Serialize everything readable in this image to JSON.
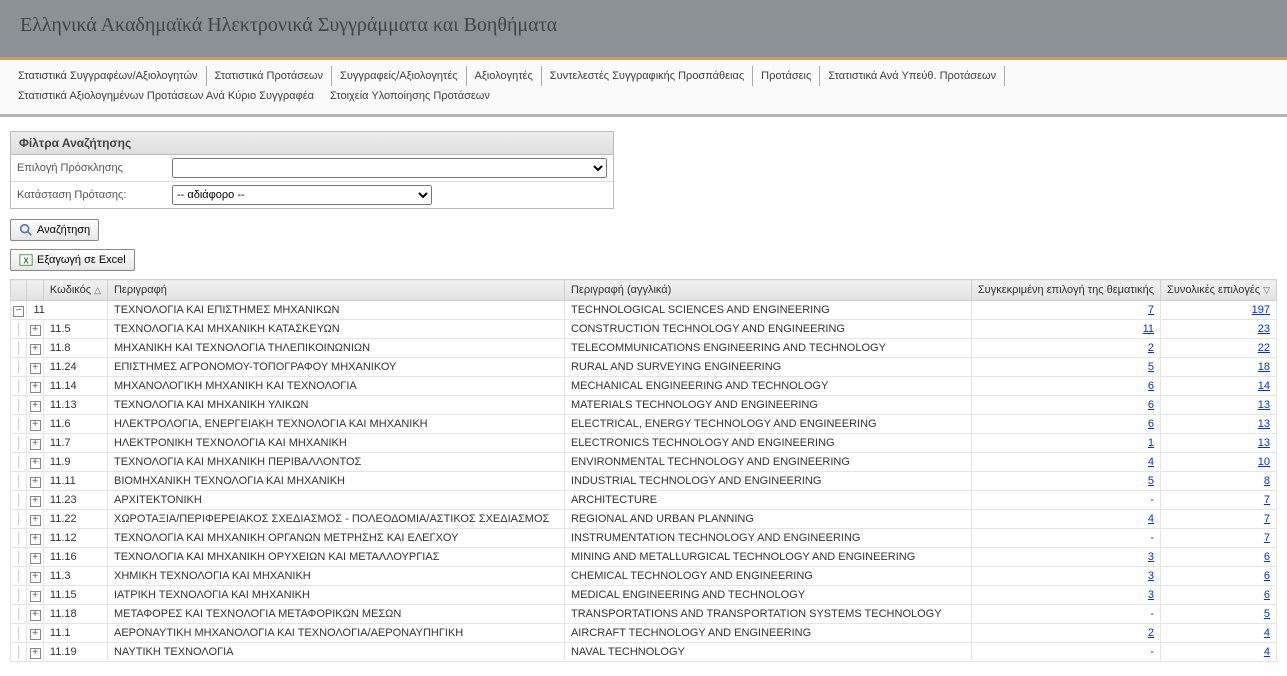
{
  "title": "Ελληνικά Ακαδημαϊκά Ηλεκτρονικά Συγγράμματα και Βοηθήματα",
  "menu": [
    "Στατιστικά Συγγραφέων/Αξιολογητών",
    "Στατιστικά Προτάσεων",
    "Συγγραφείς/Αξιολογητές",
    "Αξιολογητές",
    "Συντελεστές Συγγραφικής Προσπάθειας",
    "Προτάσεις",
    "Στατιστικά Ανά Υπεύθ. Προτάσεων",
    "Στατιστικά Αξιολογημένων Προτάσεων Ανά Κύριο Συγγραφέα",
    "Στοιχεία Υλοποίησης Προτάσεων"
  ],
  "filters": {
    "header": "Φίλτρα Αναζήτησης",
    "invitation_label": "Επιλογή Πρόσκλησης",
    "invitation_value": "",
    "status_label": "Κατάσταση Πρότασης:",
    "status_value": "-- αδιάφορο --"
  },
  "buttons": {
    "search": "Αναζήτηση",
    "excel": "Εξαγωγή σε Excel"
  },
  "grid": {
    "headers": {
      "code": "Κωδικός",
      "desc": "Περιγραφή",
      "desc_en": "Περιγραφή (αγγλικά)",
      "specific": "Συγκεκριμένη επιλογή της θεματικής",
      "total": "Συνολικές επιλογές"
    },
    "root": {
      "code": "11",
      "desc": "ΤΕΧΝΟΛΟΓΙΑ ΚΑΙ ΕΠΙΣΤΗΜΕΣ ΜΗΧΑΝΙΚΩΝ",
      "desc_en": "TECHNOLOGICAL SCIENCES AND ENGINEERING",
      "specific": "7",
      "total": "197"
    },
    "rows": [
      {
        "code": "11.5",
        "desc": "ΤΕΧΝΟΛΟΓΙΑ ΚΑΙ ΜΗΧΑΝΙΚΗ ΚΑΤΑΣΚΕΥΩΝ",
        "desc_en": "CONSTRUCTION TECHNOLOGY AND ENGINEERING",
        "specific": "11",
        "total": "23"
      },
      {
        "code": "11.8",
        "desc": "ΜΗΧΑΝΙΚΗ ΚΑΙ ΤΕΧΝΟΛΟΓΙΑ ΤΗΛΕΠΙΚΟΙΝΩΝΙΩΝ",
        "desc_en": "TELECOMMUNICATIONS ENGINEERING AND TECHNOLOGY",
        "specific": "2",
        "total": "22"
      },
      {
        "code": "11.24",
        "desc": "ΕΠΙΣΤΗΜΕΣ ΑΓΡΟΝΟΜΟΥ-ΤΟΠΟΓΡΑΦΟΥ ΜΗΧΑΝΙΚΟΥ",
        "desc_en": "RURAL AND SURVEYING ENGINEERING",
        "specific": "5",
        "total": "18"
      },
      {
        "code": "11.14",
        "desc": "ΜΗΧΑΝΟΛΟΓΙΚΗ ΜΗΧΑΝΙΚΗ ΚΑΙ ΤΕΧΝΟΛΟΓΙΑ",
        "desc_en": "MECHANICAL ENGINEERING AND TECHNOLOGY",
        "specific": "6",
        "total": "14"
      },
      {
        "code": "11.13",
        "desc": "ΤΕΧΝΟΛΟΓΙΑ ΚΑΙ ΜΗΧΑΝΙΚΗ ΥΛΙΚΩΝ",
        "desc_en": "MATERIALS TECHNOLOGY AND ENGINEERING",
        "specific": "6",
        "total": "13"
      },
      {
        "code": "11.6",
        "desc": "ΗΛΕΚΤΡΟΛΟΓΙΑ, ΕΝΕΡΓΕΙΑΚΗ ΤΕΧΝΟΛΟΓΙΑ ΚΑΙ ΜΗΧΑΝΙΚΗ",
        "desc_en": "ELECTRICAL, ENERGY TECHNOLOGY AND ENGINEERING",
        "specific": "6",
        "total": "13"
      },
      {
        "code": "11.7",
        "desc": "ΗΛΕΚΤΡΟΝΙΚΗ ΤΕΧΝΟΛΟΓΙΑ ΚΑΙ ΜΗΧΑΝΙΚΗ",
        "desc_en": "ELECTRONICS TECHNOLOGY AND ENGINEERING",
        "specific": "1",
        "total": "13"
      },
      {
        "code": "11.9",
        "desc": "ΤΕΧΝΟΛΟΓΙΑ ΚΑΙ ΜΗΧΑΝΙΚΗ ΠΕΡΙΒΑΛΛΟΝΤΟΣ",
        "desc_en": "ENVIRONMENTAL TECHNOLOGY AND ENGINEERING",
        "specific": "4",
        "total": "10"
      },
      {
        "code": "11.11",
        "desc": "ΒΙΟΜΗΧΑΝΙΚΗ ΤΕΧΝΟΛΟΓΙΑ ΚΑΙ ΜΗΧΑΝΙΚΗ",
        "desc_en": "INDUSTRIAL TECHNOLOGY AND ENGINEERING",
        "specific": "5",
        "total": "8"
      },
      {
        "code": "11.23",
        "desc": "ΑΡΧΙΤΕΚΤΟΝΙΚΗ",
        "desc_en": "ARCHITECTURE",
        "specific": "-",
        "total": "7"
      },
      {
        "code": "11.22",
        "desc": "ΧΩΡΟΤΑΞΙΑ/ΠΕΡΙΦΕΡΕΙΑΚΟΣ ΣΧΕΔΙΑΣΜΟΣ - ΠΟΛΕΟΔΟΜΙΑ/ΑΣΤΙΚΟΣ ΣΧΕΔΙΑΣΜΟΣ",
        "desc_en": "REGIONAL AND URBAN PLANNING",
        "specific": "4",
        "total": "7"
      },
      {
        "code": "11.12",
        "desc": "ΤΕΧΝΟΛΟΓΙΑ ΚΑΙ ΜΗΧΑΝΙΚΗ ΟΡΓΑΝΩΝ ΜΕΤΡΗΣΗΣ ΚΑΙ ΕΛΕΓΧΟΥ",
        "desc_en": "INSTRUMENTATION TECHNOLOGY AND ENGINEERING",
        "specific": "-",
        "total": "7"
      },
      {
        "code": "11.16",
        "desc": "ΤΕΧΝΟΛΟΓΙΑ ΚΑΙ ΜΗΧΑΝΙΚΗ ΟΡΥΧΕΙΩΝ ΚΑΙ ΜΕΤΑΛΛΟΥΡΓΙΑΣ",
        "desc_en": "MINING AND METALLURGICAL TECHNOLOGY AND ENGINEERING",
        "specific": "3",
        "total": "6"
      },
      {
        "code": "11.3",
        "desc": "ΧΗΜΙΚΗ ΤΕΧΝΟΛΟΓΙΑ ΚΑΙ ΜΗΧΑΝΙΚΗ",
        "desc_en": "CHEMICAL TECHNOLOGY AND ENGINEERING",
        "specific": "3",
        "total": "6"
      },
      {
        "code": "11.15",
        "desc": "ΙΑΤΡΙΚΗ ΤΕΧΝΟΛΟΓΙΑ ΚΑΙ ΜΗΧΑΝΙΚΗ",
        "desc_en": "MEDICAL ENGINEERING AND TECHNOLOGY",
        "specific": "3",
        "total": "6"
      },
      {
        "code": "11.18",
        "desc": "ΜΕΤΑΦΟΡΕΣ ΚΑΙ ΤΕΧΝΟΛΟΓΙΑ ΜΕΤΑΦΟΡΙΚΩΝ ΜΕΣΩΝ",
        "desc_en": "TRANSPORTATIONS AND TRANSPORTATION SYSTEMS TECHNOLOGY",
        "specific": "-",
        "total": "5"
      },
      {
        "code": "11.1",
        "desc": "ΑΕΡΟΝΑΥΤΙΚΗ ΜΗΧΑΝΟΛΟΓΙΑ ΚΑΙ ΤΕΧΝΟΛΟΓΙΑ/ΑΕΡΟΝΑΥΠΗΓΙΚΗ",
        "desc_en": "AIRCRAFT TECHNOLOGY AND ENGINEERING",
        "specific": "2",
        "total": "4"
      },
      {
        "code": "11.19",
        "desc": "ΝΑΥΤΙΚΗ ΤΕΧΝΟΛΟΓΙΑ",
        "desc_en": "NAVAL TECHNOLOGY",
        "specific": "-",
        "total": "4"
      }
    ]
  }
}
